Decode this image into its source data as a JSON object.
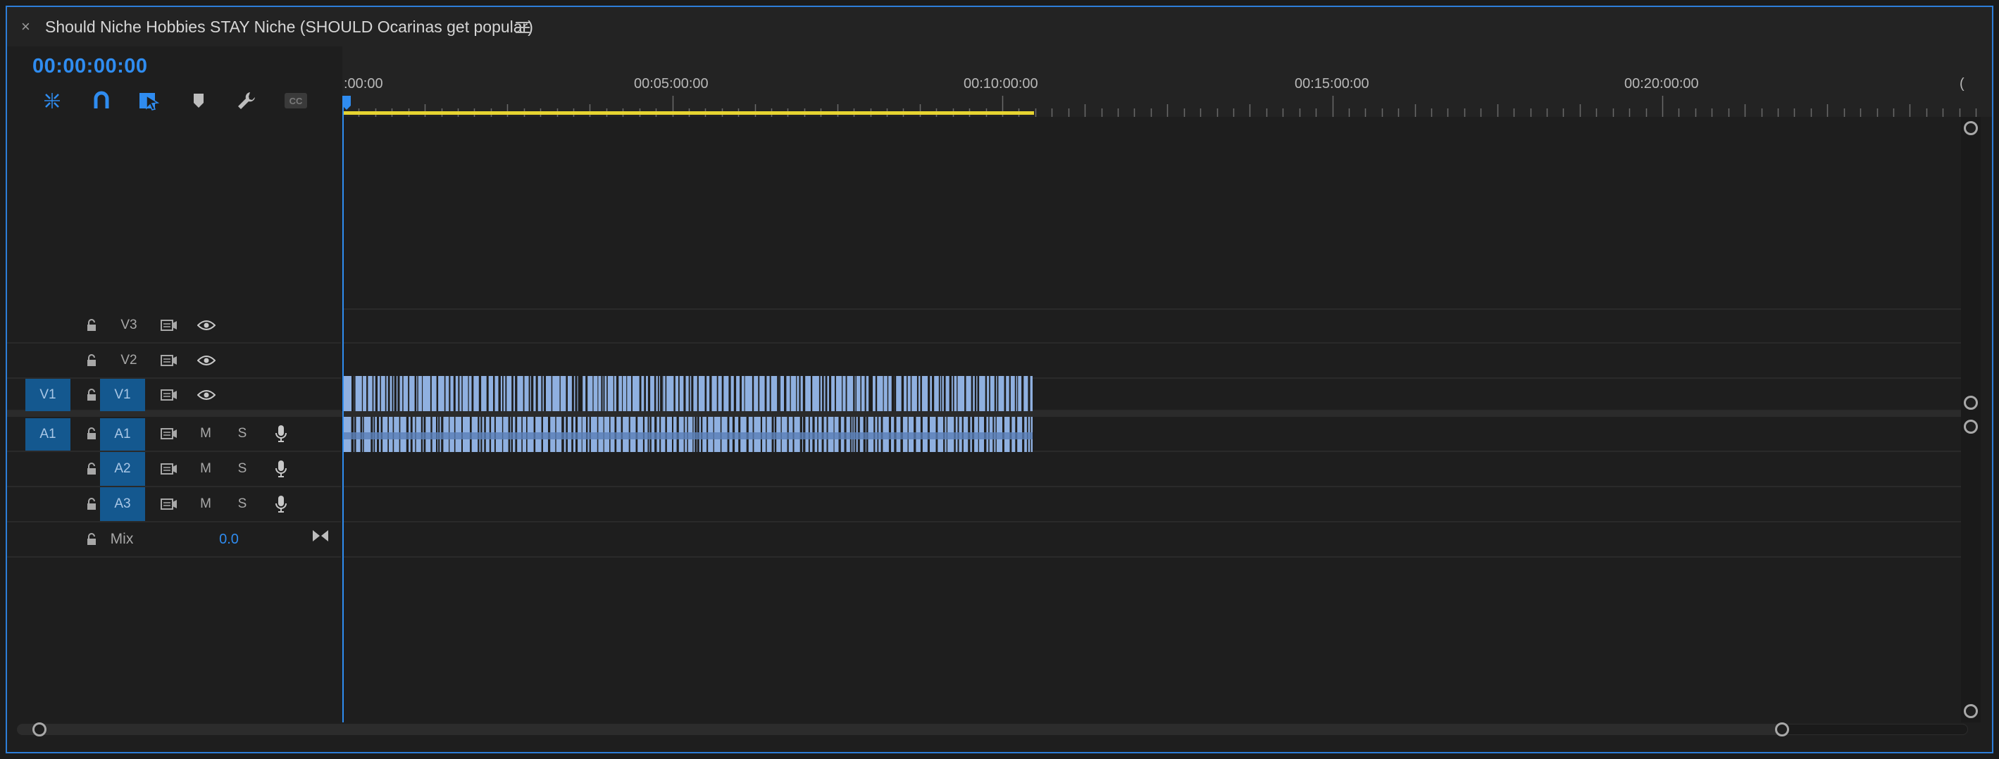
{
  "window": {
    "title": "Should Niche Hobbies STAY Niche (SHOULD Ocarinas get popular)",
    "close_glyph": "×",
    "menu_icon": "hamburger-icon"
  },
  "sequence": {
    "timecode": "00:00:00:00"
  },
  "toolbar": {
    "items": [
      {
        "name": "insert-overwrite-nest-icon",
        "active": true
      },
      {
        "name": "snap-magnet-icon",
        "active": true
      },
      {
        "name": "linked-selection-icon",
        "active": true
      },
      {
        "name": "add-marker-icon",
        "active": false
      },
      {
        "name": "settings-wrench-icon",
        "active": false
      },
      {
        "name": "captions-cc-icon",
        "active": false,
        "label": "CC"
      }
    ]
  },
  "ruler": {
    "labels": [
      ":00:00",
      "00:05:00:00",
      "00:10:00:00",
      "00:15:00:00",
      "00:20:00:00",
      "("
    ]
  },
  "tracks": {
    "video": [
      {
        "label": "V3",
        "source": "",
        "targeted": false
      },
      {
        "label": "V2",
        "source": "",
        "targeted": false
      },
      {
        "label": "V1",
        "source": "V1",
        "targeted": true
      }
    ],
    "audio": [
      {
        "label": "A1",
        "source": "A1",
        "targeted": true,
        "mute": "M",
        "solo": "S"
      },
      {
        "label": "A2",
        "source": "",
        "targeted": true,
        "mute": "M",
        "solo": "S"
      },
      {
        "label": "A3",
        "source": "",
        "targeted": true,
        "mute": "M",
        "solo": "S"
      }
    ],
    "mix": {
      "label": "Mix",
      "value": "0.0"
    }
  },
  "colors": {
    "accent": "#2f8cf0",
    "clip": "#8fb0e0",
    "work_area": "#e7d431",
    "target": "#14588f"
  }
}
